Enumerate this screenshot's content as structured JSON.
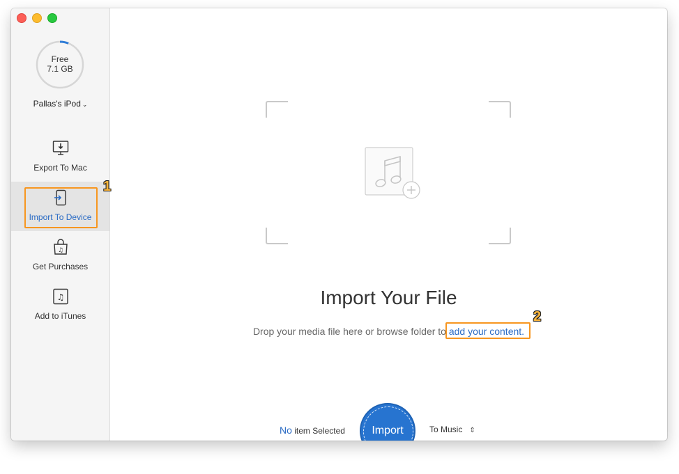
{
  "sidebar": {
    "storage": {
      "line1": "Free",
      "line2": "7.1 GB",
      "used_fraction": 0.06
    },
    "device_name": "Pallas's iPod",
    "device_chevron": "⌄",
    "items": [
      {
        "label": "Export To Mac",
        "icon": "monitor-download-icon"
      },
      {
        "label": "Import To Device",
        "icon": "phone-import-icon",
        "active": true
      },
      {
        "label": "Get Purchases",
        "icon": "shopping-bag-music-icon"
      },
      {
        "label": "Add to iTunes",
        "icon": "music-note-box-icon"
      }
    ]
  },
  "annotations": {
    "badge1": "1",
    "badge2": "2",
    "highlight_color": "#f7961f"
  },
  "main": {
    "title": "Import Your File",
    "subtitle_prefix": "Drop your media file here or browse folder to ",
    "subtitle_link": "add your content.",
    "status_count": "No",
    "status_text": " item Selected",
    "import_button": "Import",
    "target": "To Music",
    "target_icon": "⌃⌄"
  },
  "colors": {
    "accent": "#2774d0",
    "link": "#2a6bc4"
  }
}
